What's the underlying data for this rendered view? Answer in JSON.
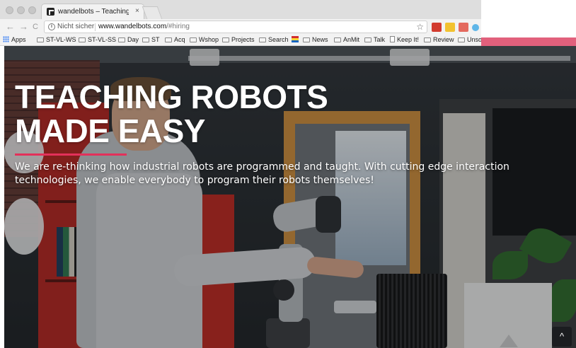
{
  "browser": {
    "tab": {
      "title": "wandelbots – Teaching robots",
      "close_label": "×"
    },
    "toolbar": {
      "back_glyph": "←",
      "forward_glyph": "→",
      "reload_glyph": "C",
      "security_label": "Nicht sicher",
      "url_host": "www.wandelbots.com",
      "url_path": "/#hiring",
      "star_glyph": "☆"
    },
    "bookmarks": [
      {
        "label": "Apps",
        "icon": "apps-icon"
      },
      {
        "label": "ST-VL-WS",
        "icon": "folder-icon"
      },
      {
        "label": "ST-VL-SS",
        "icon": "folder-icon"
      },
      {
        "label": "Day",
        "icon": "folder-icon"
      },
      {
        "label": "ST",
        "icon": "folder-icon"
      },
      {
        "label": "Acq",
        "icon": "folder-icon"
      },
      {
        "label": "Wshop",
        "icon": "folder-icon"
      },
      {
        "label": "Projects",
        "icon": "folder-icon"
      },
      {
        "label": "Search",
        "icon": "folder-icon"
      },
      {
        "label": "",
        "icon": "flag-icon"
      },
      {
        "label": "News",
        "icon": "folder-icon"
      },
      {
        "label": "AnMit",
        "icon": "folder-icon"
      },
      {
        "label": "Talk",
        "icon": "folder-icon"
      },
      {
        "label": "Keep It!",
        "icon": "page-icon"
      },
      {
        "label": "Review",
        "icon": "folder-icon"
      },
      {
        "label": "Unso",
        "icon": "folder-icon"
      }
    ]
  },
  "hero": {
    "title_line1": "TEACHING ROBOTS",
    "title_line2": "MADE EASY",
    "text": "We are re-thinking how industrial robots are programmed and taught. With cutting edge interaction technologies, we enable everybody to program their robots themselves!",
    "accent_color": "#e3305a"
  },
  "scroll_top_glyph": "^"
}
